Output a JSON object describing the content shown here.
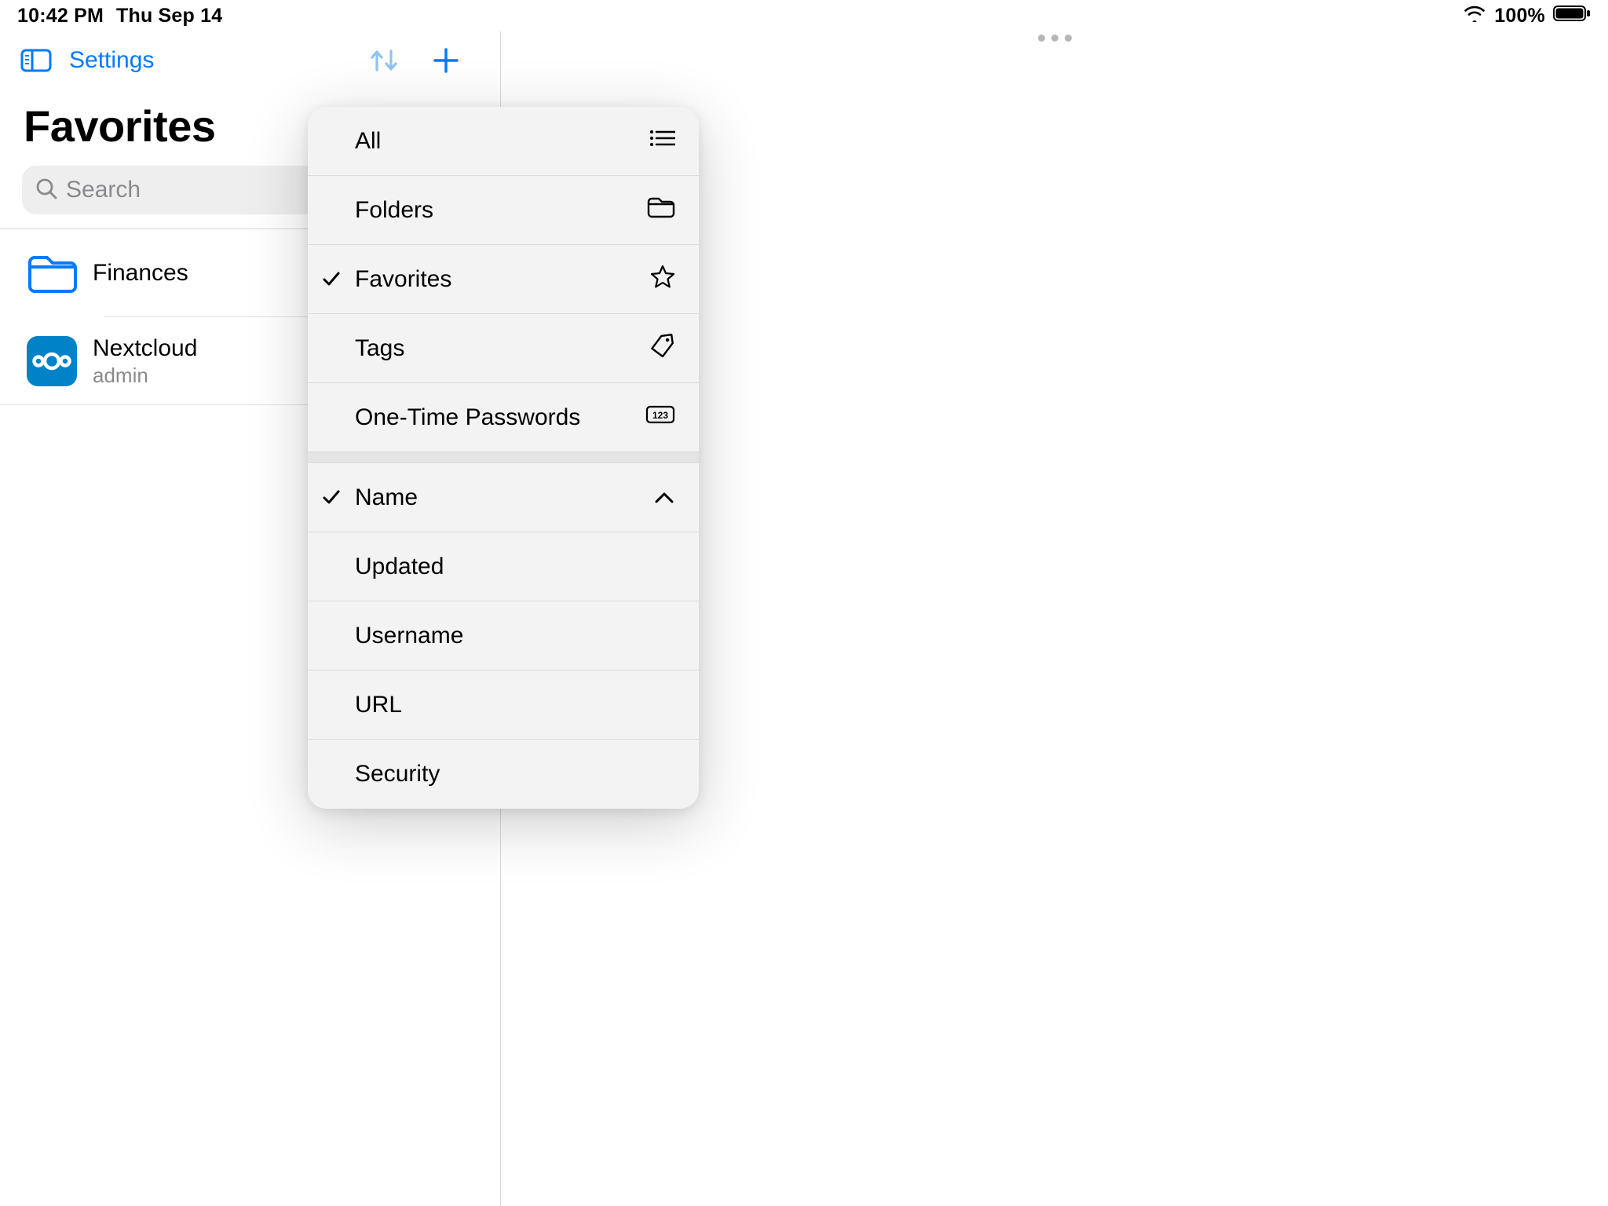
{
  "status_bar": {
    "time": "10:42 PM",
    "date": "Thu Sep 14",
    "battery_pct": "100%"
  },
  "nav": {
    "settings": "Settings"
  },
  "page_title": "Favorites",
  "search": {
    "placeholder": "Search"
  },
  "items": [
    {
      "primary": "Finances",
      "secondary": ""
    },
    {
      "primary": "Nextcloud",
      "secondary": "admin"
    }
  ],
  "menu": {
    "filter": [
      {
        "label": "All",
        "checked": false,
        "icon": "list"
      },
      {
        "label": "Folders",
        "checked": false,
        "icon": "folder"
      },
      {
        "label": "Favorites",
        "checked": true,
        "icon": "star"
      },
      {
        "label": "Tags",
        "checked": false,
        "icon": "tag"
      },
      {
        "label": "One-Time Passwords",
        "checked": false,
        "icon": "otp"
      }
    ],
    "sort": [
      {
        "label": "Name",
        "checked": true,
        "icon": "chevron-up"
      },
      {
        "label": "Updated",
        "checked": false,
        "icon": ""
      },
      {
        "label": "Username",
        "checked": false,
        "icon": ""
      },
      {
        "label": "URL",
        "checked": false,
        "icon": ""
      },
      {
        "label": "Security",
        "checked": false,
        "icon": ""
      }
    ]
  },
  "colors": {
    "accent": "#007aff",
    "nextcloud": "#0082c9"
  }
}
